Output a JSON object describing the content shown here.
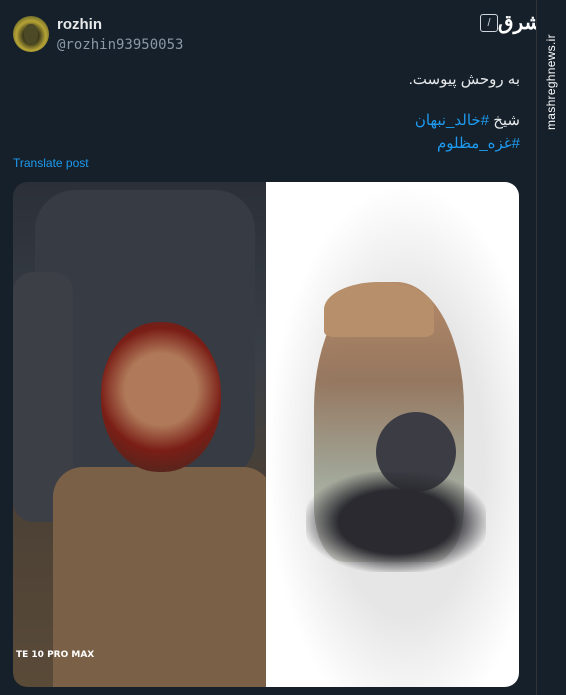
{
  "user": {
    "name": "rozhin",
    "handle": "@rozhin93950053"
  },
  "post": {
    "line1": "به روحش پیوست.",
    "line2_prefix": "شیخ ",
    "line2_hashtag": "#خالد_نبهان",
    "line3": "#غزه_مظلوم"
  },
  "translate_label": "Translate post",
  "media": {
    "watermark": "TE 10 PRO MAX"
  },
  "brand": {
    "logo_text": "مشرق",
    "site": "mashreghnews.ir"
  }
}
